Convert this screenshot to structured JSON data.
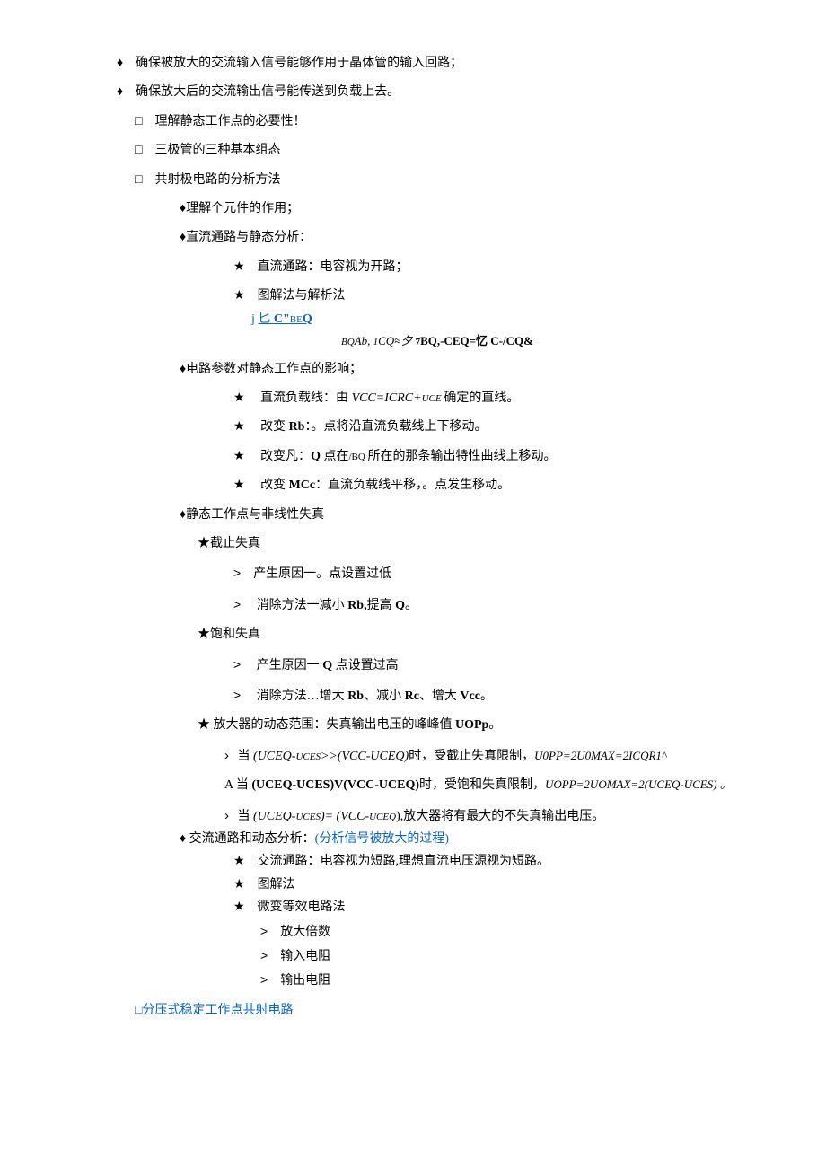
{
  "lines": {
    "l1": "确保被放大的交流输入信号能够作用于晶体管的输入回路；",
    "l2": "确保放大后的交流输出信号能传送到负载上去。",
    "l3": "理解静态工作点的必要性！",
    "l4": "三极管的三种基本组态",
    "l5": "共射极电路的分析方法",
    "l6": "理解个元件的作用；",
    "l7": "直流通路与静态分析：",
    "l8": "直流通路：电容视为开路；",
    "l9": "图解法与解析法",
    "l10a": "j",
    "l10b": "匕",
    "l10c": "C\"",
    "l10d": "BE",
    "l10e": "Q",
    "l11a": "BQ",
    "l11b": "Ab,",
    "l11c": "1",
    "l11d": "CQ≈夕",
    "l11e": "7",
    "l11f": "BQ,-CEQ=忆 ",
    "l11g": "C-/CQ&",
    "l12": "电路参数对静态工作点的影响；",
    "l13a": "直流负载线：由 ",
    "l13b": "VCC=ICRC+",
    "l13c": "UCE ",
    "l13d": "确定的直线。",
    "l14a": "改变 ",
    "l14b": "Rb",
    "l14c": "：。点将沿直流负载线上下移动。",
    "l15a": "改变凡：",
    "l15b": "Q ",
    "l15c": "点在",
    "l15d": "/BQ ",
    "l15e": "所在的那条输出特性曲线上移动。",
    "l16a": "改变 ",
    "l16b": "MCc",
    "l16c": "：直流负载线平移，。点发生移动。",
    "l17": "静态工作点与非线性失真",
    "l18": "截止失真",
    "l19": "产生原因一。点设置过低",
    "l20a": "消除方法一减小 ",
    "l20b": "Rb,",
    "l20c": "提高 ",
    "l20d": "Q",
    "l20e": "。",
    "l21": "饱和失真",
    "l22a": "产生原因一 ",
    "l22b": "Q ",
    "l22c": "点设置过高",
    "l23a": "消除方法…增大 ",
    "l23b": "Rb",
    "l23c": "、减小 ",
    "l23d": "Rc",
    "l23e": "、增大 ",
    "l23f": "Vcc",
    "l23g": "。",
    "l24a": "放大器的动态范围：失真输出电压的峰峰值 ",
    "l24b": "UOPp",
    "l24c": "。",
    "l25a": "当 ",
    "l25b": "(UCEQ-",
    "l25c": "UCES",
    "l25d": ">>",
    "l25e": "(VCC-UCEQ)",
    "l25f": "时，受截止失真限制，",
    "l25g": "U0PP=2U0MAX=2ICQR1^",
    "l26a": "A 当 ",
    "l26b": "(UCEQ-UCES)V(VCC-UCEQ)",
    "l26c": "时，受饱和失真限制，",
    "l26d": "UOPP=2UOMAX=2(UCEQ-UCES) 。",
    "l27a": "当 ",
    "l27b": "(UCEQ-",
    "l27c": "UCES",
    "l27d": ")= (VCC-",
    "l27e": "UCEQ",
    "l27f": "),放大器将有最大的不失真输出电压。",
    "l28a": "交流通路和动态分析：",
    "l28b": "(分析信号被放大的过程)",
    "l29": "交流通路：电容视为短路,理想直流电压源视为短路。",
    "l30": "图解法",
    "l31": "微变等效电路法",
    "l32": "放大倍数",
    "l33": "输入电阻",
    "l34": "输出电阻",
    "l35": "□分压式稳定工作点共射电路"
  }
}
